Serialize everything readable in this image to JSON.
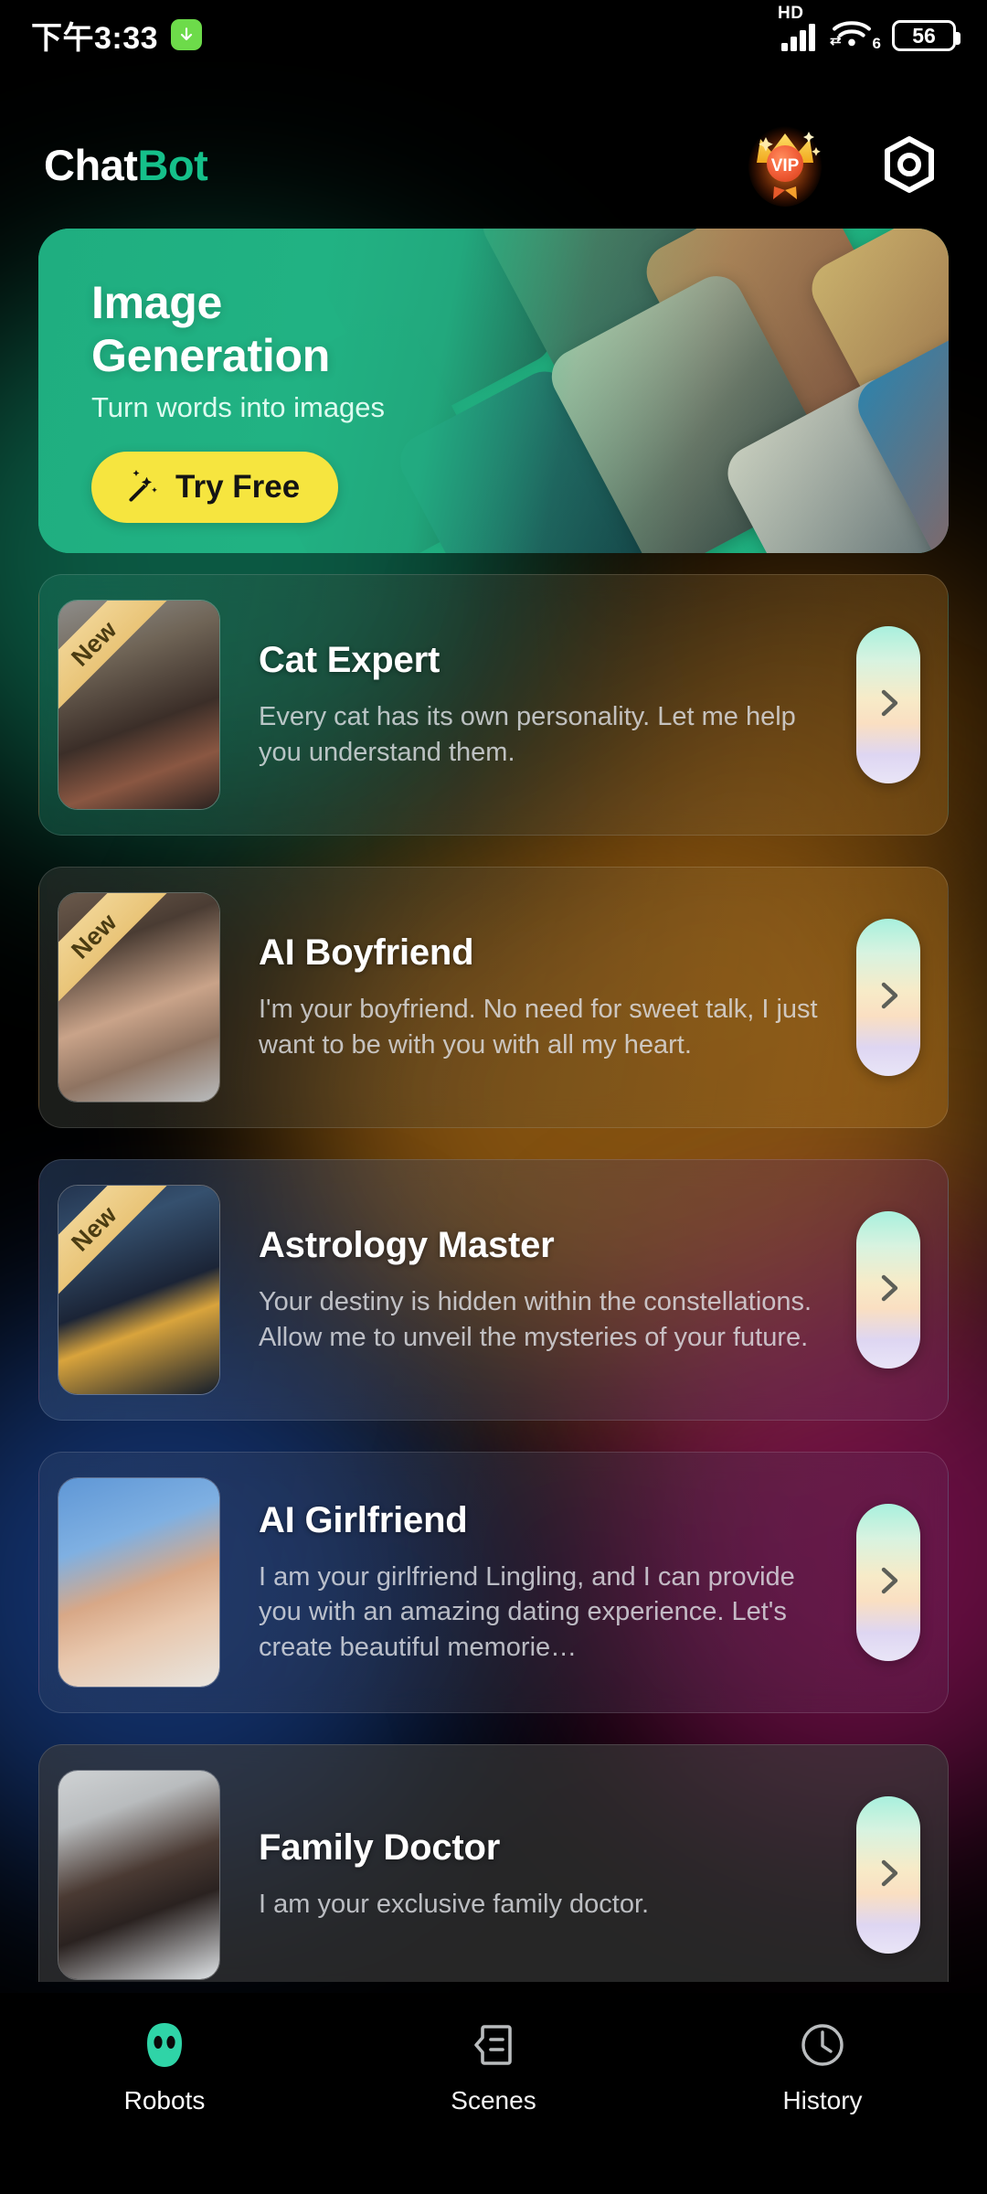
{
  "status_bar": {
    "time": "下午3:33",
    "download_icon": "download-arrow-icon",
    "network_type": "HD",
    "signal_icon": "cellular-signal-icon",
    "wifi_icon": "wifi-icon",
    "wifi_generation": "6",
    "battery_percent": "56"
  },
  "header": {
    "brand_part1": "Chat",
    "brand_part2": "Bot",
    "vip_label": "VIP",
    "vip_icon": "vip-crown-badge-icon",
    "settings_icon": "settings-hex-icon"
  },
  "banner": {
    "title_line1": "Image",
    "title_line2": "Generation",
    "subtitle": "Turn words into images",
    "cta_label": "Try Free",
    "cta_icon": "magic-wand-icon",
    "accent_color": "#21b283",
    "cta_color": "#f6e53f"
  },
  "bots": [
    {
      "name": "Cat Expert",
      "description": "Every cat has its own personality. Let me help you understand them.",
      "badge": "New",
      "is_new": true,
      "open_icon": "chevron-right-icon"
    },
    {
      "name": "AI Boyfriend",
      "description": "I'm your boyfriend. No need for sweet talk, I just want to be with you with all my heart.",
      "badge": "New",
      "is_new": true,
      "open_icon": "chevron-right-icon"
    },
    {
      "name": "Astrology Master",
      "description": "Your destiny is hidden within the constellations. Allow me to unveil the mysteries of your future.",
      "badge": "New",
      "is_new": true,
      "open_icon": "chevron-right-icon"
    },
    {
      "name": "AI Girlfriend",
      "description": "I am your girlfriend Lingling, and I can provide you with an amazing dating experience. Let's create beautiful memorie…",
      "badge": "",
      "is_new": false,
      "open_icon": "chevron-right-icon"
    },
    {
      "name": "Family Doctor",
      "description": "I am your exclusive family doctor.",
      "badge": "",
      "is_new": false,
      "open_icon": "chevron-right-icon"
    }
  ],
  "bottom_nav": {
    "active_index": 0,
    "items": [
      {
        "label": "Robots",
        "icon": "robot-face-icon",
        "active": true
      },
      {
        "label": "Scenes",
        "icon": "scenes-list-icon",
        "active": false
      },
      {
        "label": "History",
        "icon": "clock-icon",
        "active": false
      }
    ]
  }
}
